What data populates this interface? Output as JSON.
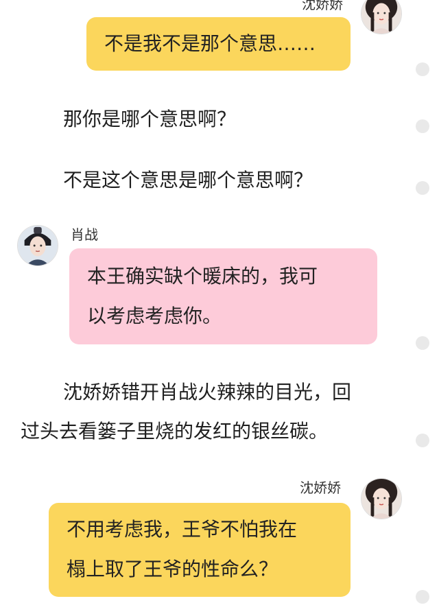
{
  "messages": [
    {
      "speaker": "沈娇娇",
      "text": "不是我不是那个意思……"
    },
    {
      "speaker": "肖战",
      "text": "本王确实缺个暖床的，我可\n以考虑考虑你。"
    },
    {
      "speaker": "沈娇娇",
      "text": "不用考虑我，王爷不怕我在\n榻上取了王爷的性命么？"
    }
  ],
  "narration": [
    "那你是哪个意思啊？",
    "不是这个意思是哪个意思啊？",
    "沈娇娇错开肖战火辣辣的目光，回",
    "过头去看篓子里烧的发红的银丝碳。"
  ],
  "avatars": {
    "shen_jiaojiao": "woman-portrait-avatar",
    "xiao_zhan": "man-portrait-avatar"
  },
  "colors": {
    "yellow_bubble": "#fbd65c",
    "pink_bubble": "#fdcbd9"
  }
}
